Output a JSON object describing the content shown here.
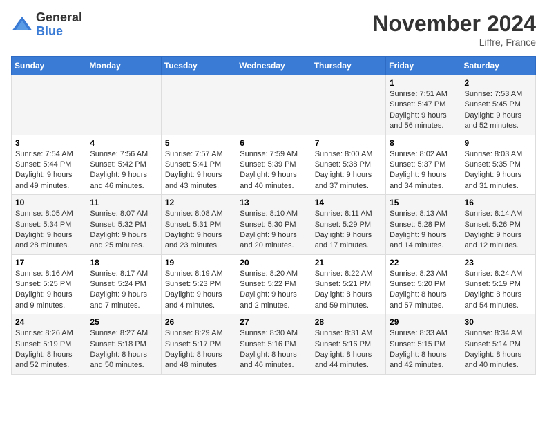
{
  "header": {
    "logo_general": "General",
    "logo_blue": "Blue",
    "month_title": "November 2024",
    "location": "Liffre, France"
  },
  "days_of_week": [
    "Sunday",
    "Monday",
    "Tuesday",
    "Wednesday",
    "Thursday",
    "Friday",
    "Saturday"
  ],
  "weeks": [
    {
      "days": [
        {
          "num": "",
          "info": ""
        },
        {
          "num": "",
          "info": ""
        },
        {
          "num": "",
          "info": ""
        },
        {
          "num": "",
          "info": ""
        },
        {
          "num": "",
          "info": ""
        },
        {
          "num": "1",
          "info": "Sunrise: 7:51 AM\nSunset: 5:47 PM\nDaylight: 9 hours and 56 minutes."
        },
        {
          "num": "2",
          "info": "Sunrise: 7:53 AM\nSunset: 5:45 PM\nDaylight: 9 hours and 52 minutes."
        }
      ]
    },
    {
      "days": [
        {
          "num": "3",
          "info": "Sunrise: 7:54 AM\nSunset: 5:44 PM\nDaylight: 9 hours and 49 minutes."
        },
        {
          "num": "4",
          "info": "Sunrise: 7:56 AM\nSunset: 5:42 PM\nDaylight: 9 hours and 46 minutes."
        },
        {
          "num": "5",
          "info": "Sunrise: 7:57 AM\nSunset: 5:41 PM\nDaylight: 9 hours and 43 minutes."
        },
        {
          "num": "6",
          "info": "Sunrise: 7:59 AM\nSunset: 5:39 PM\nDaylight: 9 hours and 40 minutes."
        },
        {
          "num": "7",
          "info": "Sunrise: 8:00 AM\nSunset: 5:38 PM\nDaylight: 9 hours and 37 minutes."
        },
        {
          "num": "8",
          "info": "Sunrise: 8:02 AM\nSunset: 5:37 PM\nDaylight: 9 hours and 34 minutes."
        },
        {
          "num": "9",
          "info": "Sunrise: 8:03 AM\nSunset: 5:35 PM\nDaylight: 9 hours and 31 minutes."
        }
      ]
    },
    {
      "days": [
        {
          "num": "10",
          "info": "Sunrise: 8:05 AM\nSunset: 5:34 PM\nDaylight: 9 hours and 28 minutes."
        },
        {
          "num": "11",
          "info": "Sunrise: 8:07 AM\nSunset: 5:32 PM\nDaylight: 9 hours and 25 minutes."
        },
        {
          "num": "12",
          "info": "Sunrise: 8:08 AM\nSunset: 5:31 PM\nDaylight: 9 hours and 23 minutes."
        },
        {
          "num": "13",
          "info": "Sunrise: 8:10 AM\nSunset: 5:30 PM\nDaylight: 9 hours and 20 minutes."
        },
        {
          "num": "14",
          "info": "Sunrise: 8:11 AM\nSunset: 5:29 PM\nDaylight: 9 hours and 17 minutes."
        },
        {
          "num": "15",
          "info": "Sunrise: 8:13 AM\nSunset: 5:28 PM\nDaylight: 9 hours and 14 minutes."
        },
        {
          "num": "16",
          "info": "Sunrise: 8:14 AM\nSunset: 5:26 PM\nDaylight: 9 hours and 12 minutes."
        }
      ]
    },
    {
      "days": [
        {
          "num": "17",
          "info": "Sunrise: 8:16 AM\nSunset: 5:25 PM\nDaylight: 9 hours and 9 minutes."
        },
        {
          "num": "18",
          "info": "Sunrise: 8:17 AM\nSunset: 5:24 PM\nDaylight: 9 hours and 7 minutes."
        },
        {
          "num": "19",
          "info": "Sunrise: 8:19 AM\nSunset: 5:23 PM\nDaylight: 9 hours and 4 minutes."
        },
        {
          "num": "20",
          "info": "Sunrise: 8:20 AM\nSunset: 5:22 PM\nDaylight: 9 hours and 2 minutes."
        },
        {
          "num": "21",
          "info": "Sunrise: 8:22 AM\nSunset: 5:21 PM\nDaylight: 8 hours and 59 minutes."
        },
        {
          "num": "22",
          "info": "Sunrise: 8:23 AM\nSunset: 5:20 PM\nDaylight: 8 hours and 57 minutes."
        },
        {
          "num": "23",
          "info": "Sunrise: 8:24 AM\nSunset: 5:19 PM\nDaylight: 8 hours and 54 minutes."
        }
      ]
    },
    {
      "days": [
        {
          "num": "24",
          "info": "Sunrise: 8:26 AM\nSunset: 5:19 PM\nDaylight: 8 hours and 52 minutes."
        },
        {
          "num": "25",
          "info": "Sunrise: 8:27 AM\nSunset: 5:18 PM\nDaylight: 8 hours and 50 minutes."
        },
        {
          "num": "26",
          "info": "Sunrise: 8:29 AM\nSunset: 5:17 PM\nDaylight: 8 hours and 48 minutes."
        },
        {
          "num": "27",
          "info": "Sunrise: 8:30 AM\nSunset: 5:16 PM\nDaylight: 8 hours and 46 minutes."
        },
        {
          "num": "28",
          "info": "Sunrise: 8:31 AM\nSunset: 5:16 PM\nDaylight: 8 hours and 44 minutes."
        },
        {
          "num": "29",
          "info": "Sunrise: 8:33 AM\nSunset: 5:15 PM\nDaylight: 8 hours and 42 minutes."
        },
        {
          "num": "30",
          "info": "Sunrise: 8:34 AM\nSunset: 5:14 PM\nDaylight: 8 hours and 40 minutes."
        }
      ]
    }
  ]
}
